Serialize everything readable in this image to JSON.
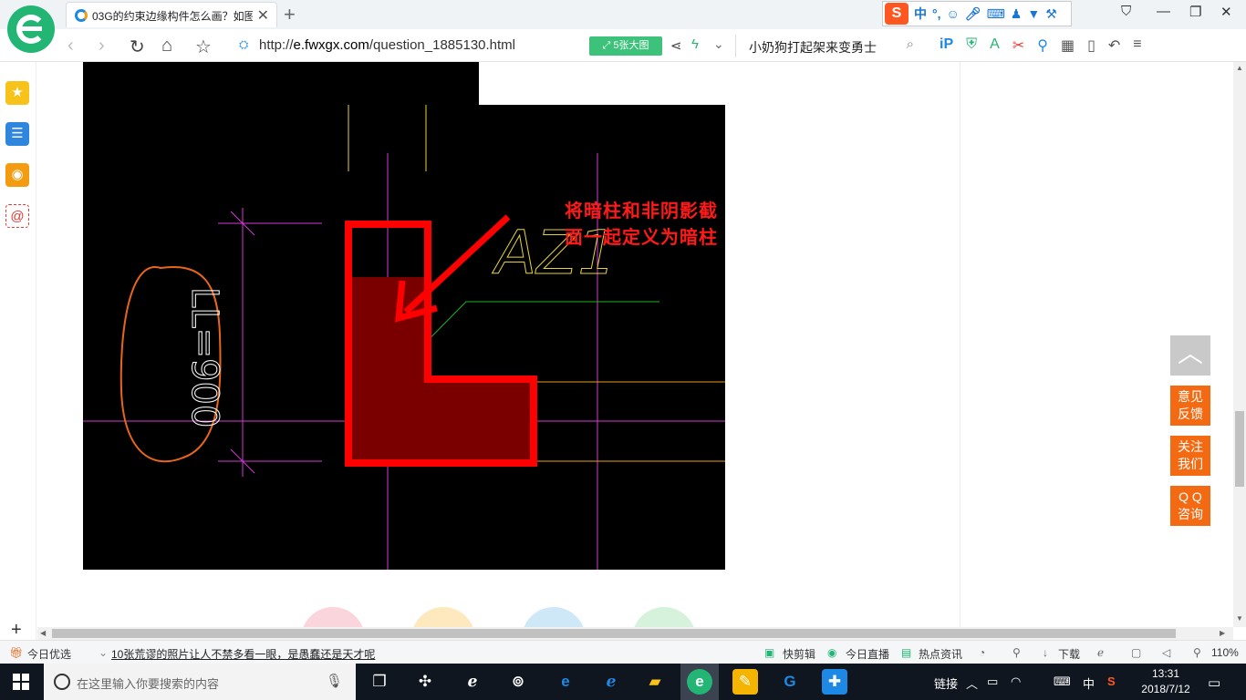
{
  "browser": {
    "tab_title": "03G的约束边缘构件怎么画？如图",
    "url_prefix": "http://",
    "url_domain": "e.fwxgx.com",
    "url_path": "/question_1885130.html",
    "image_badge": "5张大图",
    "search_query": "小奶狗打起架来变勇士"
  },
  "ime": {
    "lang": "中"
  },
  "page": {
    "annotation": "将暗柱和非阴影截面一起定义为暗柱",
    "cad_labels": {
      "dim": "LL=900",
      "tag": "AZ1"
    },
    "float_buttons": [
      {
        "line1": "意见",
        "line2": "反馈"
      },
      {
        "line1": "关注",
        "line2": "我们"
      },
      {
        "line1": "Q Q",
        "line2": "咨询"
      }
    ],
    "circle_colors": [
      "#fbd5dc",
      "#fde9bd",
      "#cfe8f8",
      "#d6f1dc"
    ]
  },
  "statusbar": {
    "today": "今日优选",
    "news": "10张荒谬的照片让人不禁多看一眼，是愚蠢还是天才呢",
    "kuaijianji": "快剪辑",
    "live": "今日直播",
    "hot": "热点资讯",
    "download": "下载",
    "zoom": "110%"
  },
  "taskbar": {
    "search_placeholder": "在这里输入你要搜索的内容",
    "link": "链接",
    "ime": "中",
    "time": "13:31",
    "date": "2018/7/12"
  },
  "colors": {
    "accent_green": "#22b573",
    "annotation_red": "#ff1a1a",
    "float_orange": "#f46a12"
  }
}
